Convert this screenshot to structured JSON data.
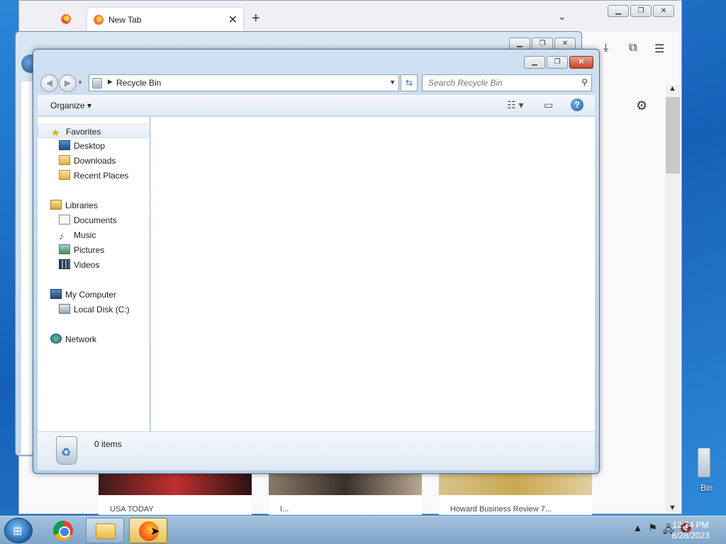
{
  "desktop": {
    "recycle_bin_label": "Bin"
  },
  "firefox": {
    "tab_title": "New Tab",
    "tab_close": "✕",
    "new_tab": "+",
    "list_tabs": "⌄",
    "cards": [
      "USA TODAY",
      "I...",
      "Howard Business Review 7..."
    ]
  },
  "explorer": {
    "address_path": "Recycle Bin",
    "search_placeholder": "Search Recycle Bin",
    "organize_label": "Organize",
    "favorites": "Favorites",
    "desktop_item": "Desktop",
    "downloads": "Downloads",
    "recent_places": "Recent Places",
    "libraries": "Libraries",
    "documents": "Documents",
    "music": "Music",
    "pictures": "Pictures",
    "videos": "Videos",
    "my_computer": "My Computer",
    "local_disk": "Local Disk (C:)",
    "network": "Network",
    "item_count": "0 items"
  },
  "taskbar": {
    "time": "12:34 PM",
    "date": "8/28/2023"
  },
  "colors": {
    "taskbar_active": "#e6c45a",
    "window_frame": "#b9d1ea",
    "desktop_bg": "#1d6fc4"
  }
}
